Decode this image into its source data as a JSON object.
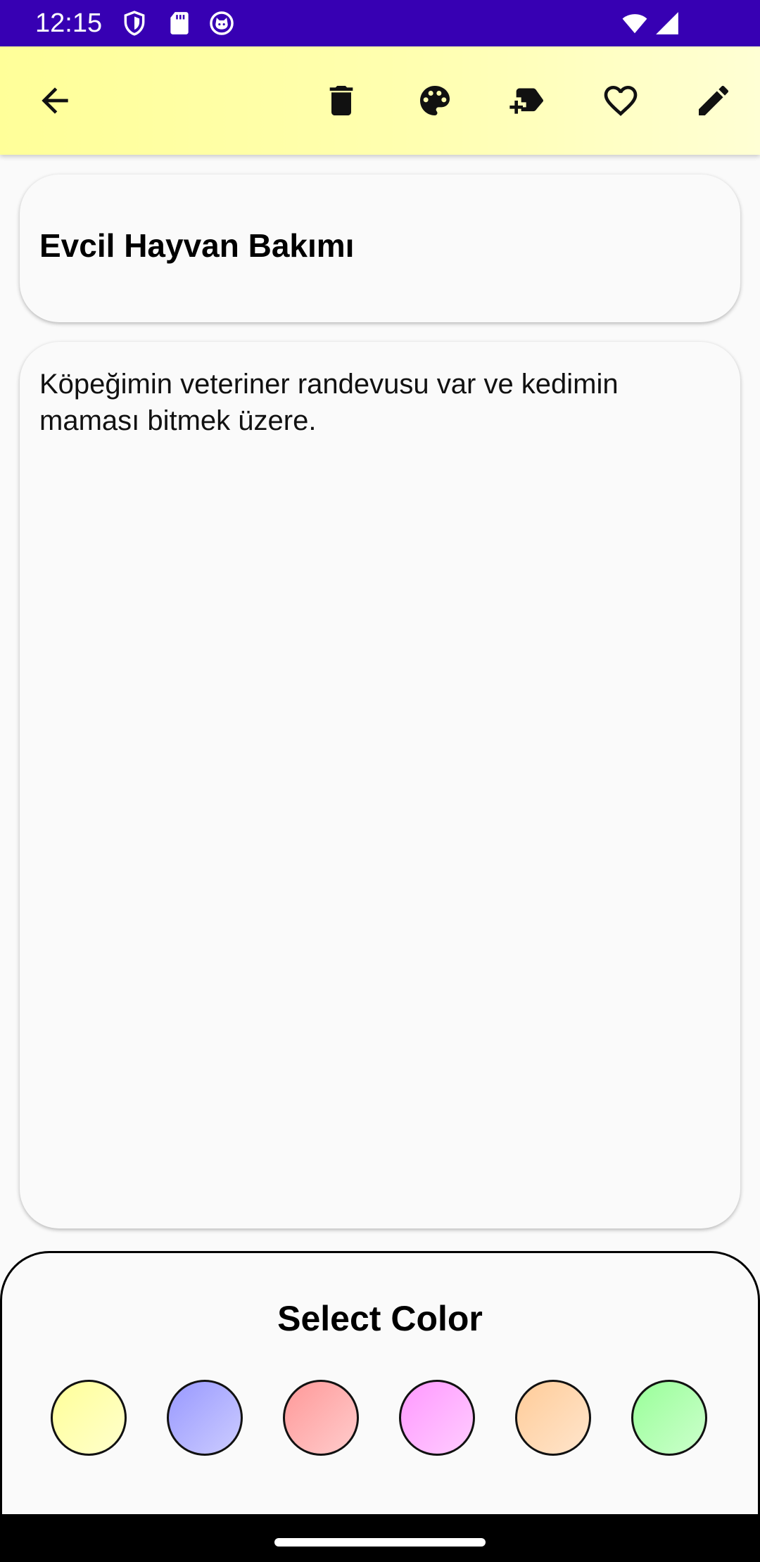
{
  "status_bar": {
    "time": "12:15",
    "icons": [
      "shield-icon",
      "sd-card-icon",
      "cat-face-icon",
      "wifi-icon",
      "signal-icon"
    ],
    "background": "#3700b3"
  },
  "toolbar": {
    "background": "#ffff99",
    "buttons": [
      "back-arrow-icon",
      "trash-icon",
      "palette-icon",
      "add-label-icon",
      "heart-icon",
      "pencil-icon"
    ]
  },
  "note": {
    "title": "Evcil Hayvan Bakımı",
    "body": "Köpeğimin veteriner randevusu var ve kedimin maması bitmek üzere."
  },
  "color_sheet": {
    "title": "Select Color",
    "colors": [
      {
        "name": "yellow",
        "light": "#ffffcc",
        "dark": "#ffff99"
      },
      {
        "name": "blue",
        "light": "#ccccff",
        "dark": "#9999ff"
      },
      {
        "name": "red",
        "light": "#ffcccc",
        "dark": "#ff9999"
      },
      {
        "name": "pink",
        "light": "#ffccff",
        "dark": "#ff99ff"
      },
      {
        "name": "orange",
        "light": "#ffe5cc",
        "dark": "#ffcc99"
      },
      {
        "name": "green",
        "light": "#ccffcc",
        "dark": "#99ff99"
      }
    ]
  }
}
